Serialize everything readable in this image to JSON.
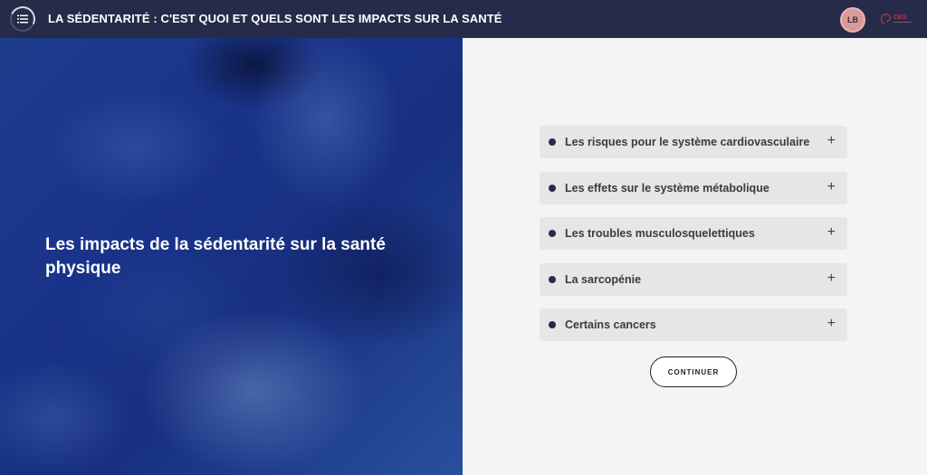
{
  "header": {
    "course_title": "LA SÉDENTARITÉ : C'EST QUOI ET QUELS SONT LES IMPACTS SUR LA SANTÉ",
    "menu_icon": "list-icon",
    "avatar_initials": "LB",
    "logo_text": "CES"
  },
  "main": {
    "heading": "Les impacts de la sédentarité sur la santé physique",
    "accordion": [
      {
        "label": "Les risques pour le système cardiovasculaire",
        "icon": "+"
      },
      {
        "label": "Les effets sur le système métabolique",
        "icon": "+"
      },
      {
        "label": "Les troubles musculosquelettiques",
        "icon": "+"
      },
      {
        "label": "La sarcopénie",
        "icon": "+"
      },
      {
        "label": "Certains cancers",
        "icon": "+"
      }
    ],
    "continue_label": "CONTINUER"
  },
  "colors": {
    "topbar": "#252b48",
    "bullet": "#252b48",
    "accordion_bg": "#e6e6e6",
    "avatar": "#d99a9a"
  }
}
